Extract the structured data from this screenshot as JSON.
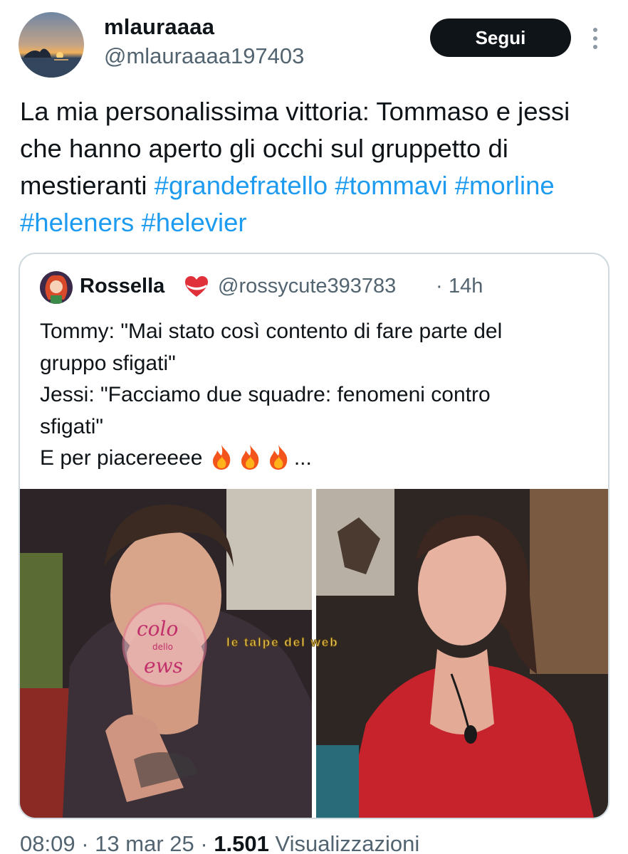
{
  "author": {
    "display_name": "mlauraaaa",
    "handle": "@mlauraaaa197403",
    "avatar_icon": "sunset-avatar"
  },
  "follow_button": {
    "label": "Segui"
  },
  "more_icon": "vertical-ellipsis-icon",
  "tweet": {
    "text_plain": "La mia personalissima vittoria: Tommaso e jessi che hanno aperto gli occhi sul gruppetto di mestieranti",
    "hashtags": [
      "#grandefratello",
      "#tommavi",
      "#morline",
      "#heleners",
      "#helevier"
    ]
  },
  "quoted_tweet": {
    "display_name": "Rossella",
    "heart_icon": "heart-ribbon-icon",
    "handle": "@rossycute393783",
    "separator": "·",
    "time": "14h",
    "lines": [
      "Tommy: \"Mai stato così contento di fare parte del",
      "gruppo sfigati\"",
      "Jessi: \"Facciamo due squadre: fenomeni contro",
      "sfigati\"",
      "E per piacereeee"
    ],
    "emoji": [
      "🔥",
      "🔥",
      "🔥"
    ],
    "ellipsis": "...",
    "media": {
      "left_photo": "man-praying-hands-photo",
      "right_photo": "woman-red-dress-photo",
      "watermark_text": "le talpe del web",
      "watermark_logo_text": [
        "colo",
        "dello",
        "ews"
      ]
    }
  },
  "footer": {
    "time": "08:09",
    "sep1": "·",
    "date": "13 mar 25",
    "sep2": "·",
    "views_count": "1.501",
    "views_label": "Visualizzazioni"
  },
  "colors": {
    "link": "#1d9bf0",
    "secondary": "#536471",
    "text": "#0f1419",
    "button": "#0f1419"
  }
}
